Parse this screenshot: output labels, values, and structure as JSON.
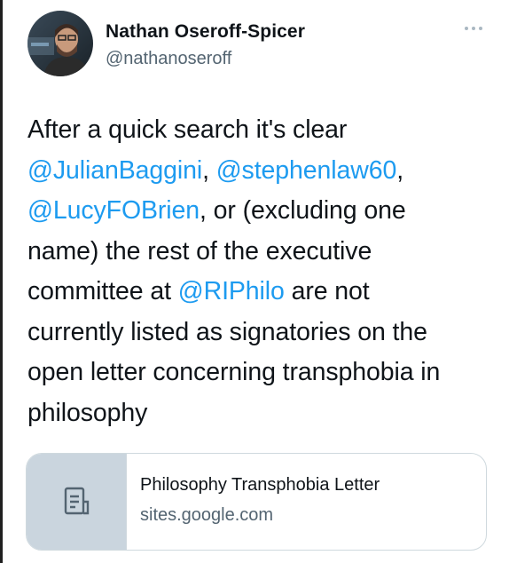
{
  "author": {
    "name": "Nathan Oseroff-Spicer",
    "handle": "@nathanoseroff",
    "avatar_icon": "profile-photo"
  },
  "tweet": {
    "lines": [
      [
        {
          "text": "After a quick search it's clear",
          "type": "text"
        }
      ],
      [
        {
          "text": "@JulianBaggini",
          "type": "mention"
        },
        {
          "text": ", ",
          "type": "text"
        },
        {
          "text": "@stephenlaw60",
          "type": "mention"
        },
        {
          "text": ",",
          "type": "text"
        }
      ],
      [
        {
          "text": "@LucyFOBrien",
          "type": "mention"
        },
        {
          "text": ", or (excluding one",
          "type": "text"
        }
      ],
      [
        {
          "text": "name) the rest of the executive",
          "type": "text"
        }
      ],
      [
        {
          "text": "committee at ",
          "type": "text"
        },
        {
          "text": "@RIPhilo",
          "type": "mention"
        },
        {
          "text": " are not",
          "type": "text"
        }
      ],
      [
        {
          "text": "currently listed as signatories on the",
          "type": "text"
        }
      ],
      [
        {
          "text": "open letter concerning transphobia in",
          "type": "text"
        }
      ],
      [
        {
          "text": "philosophy",
          "type": "text"
        }
      ]
    ]
  },
  "link_card": {
    "title": "Philosophy Transphobia Letter",
    "domain": "sites.google.com",
    "thumb_icon": "document-icon"
  },
  "colors": {
    "mention": "#1d9bf0",
    "secondary_text": "#536471",
    "card_thumb_bg": "#cad5de"
  }
}
